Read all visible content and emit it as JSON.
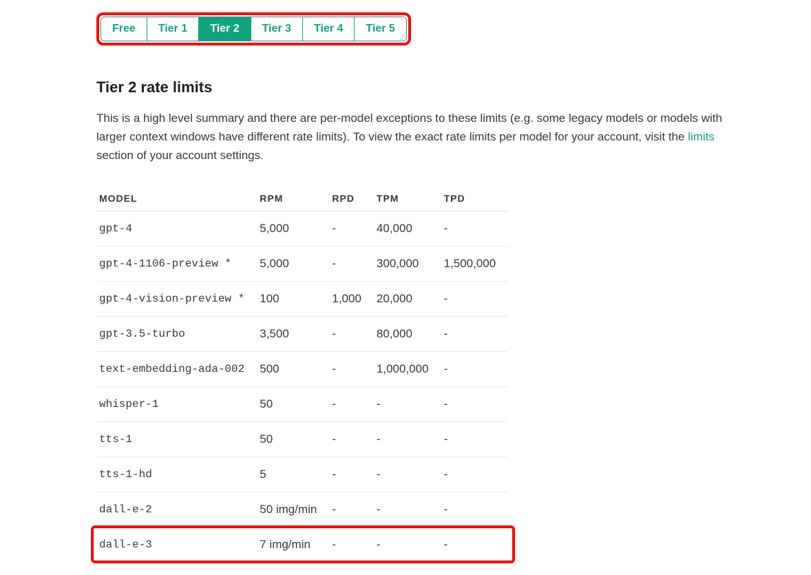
{
  "tabs": {
    "items": [
      {
        "label": "Free",
        "active": false
      },
      {
        "label": "Tier 1",
        "active": false
      },
      {
        "label": "Tier 2",
        "active": true
      },
      {
        "label": "Tier 3",
        "active": false
      },
      {
        "label": "Tier 4",
        "active": false
      },
      {
        "label": "Tier 5",
        "active": false
      }
    ]
  },
  "heading": "Tier 2 rate limits",
  "description": {
    "pre": "This is a high level summary and there are per-model exceptions to these limits (e.g. some legacy models or models with larger context windows have different rate limits). To view the exact rate limits per model for your account, visit the ",
    "link": "limits",
    "post": " section of your account settings."
  },
  "table": {
    "headers": [
      "MODEL",
      "RPM",
      "RPD",
      "TPM",
      "TPD"
    ],
    "rows": [
      {
        "model": "gpt-4",
        "rpm": "5,000",
        "rpd": "-",
        "tpm": "40,000",
        "tpd": "-"
      },
      {
        "model": "gpt-4-1106-preview *",
        "rpm": "5,000",
        "rpd": "-",
        "tpm": "300,000",
        "tpd": "1,500,000"
      },
      {
        "model": "gpt-4-vision-preview *",
        "rpm": "100",
        "rpd": "1,000",
        "tpm": "20,000",
        "tpd": "-"
      },
      {
        "model": "gpt-3.5-turbo",
        "rpm": "3,500",
        "rpd": "-",
        "tpm": "80,000",
        "tpd": "-"
      },
      {
        "model": "text-embedding-ada-002",
        "rpm": "500",
        "rpd": "-",
        "tpm": "1,000,000",
        "tpd": "-"
      },
      {
        "model": "whisper-1",
        "rpm": "50",
        "rpd": "-",
        "tpm": "-",
        "tpd": "-"
      },
      {
        "model": "tts-1",
        "rpm": "50",
        "rpd": "-",
        "tpm": "-",
        "tpd": "-"
      },
      {
        "model": "tts-1-hd",
        "rpm": "5",
        "rpd": "-",
        "tpm": "-",
        "tpd": "-"
      },
      {
        "model": "dall-e-2",
        "rpm": "50 img/min",
        "rpd": "-",
        "tpm": "-",
        "tpd": "-"
      },
      {
        "model": "dall-e-3",
        "rpm": "7 img/min",
        "rpd": "-",
        "tpm": "-",
        "tpd": "-"
      }
    ],
    "highlightRow": 9
  }
}
